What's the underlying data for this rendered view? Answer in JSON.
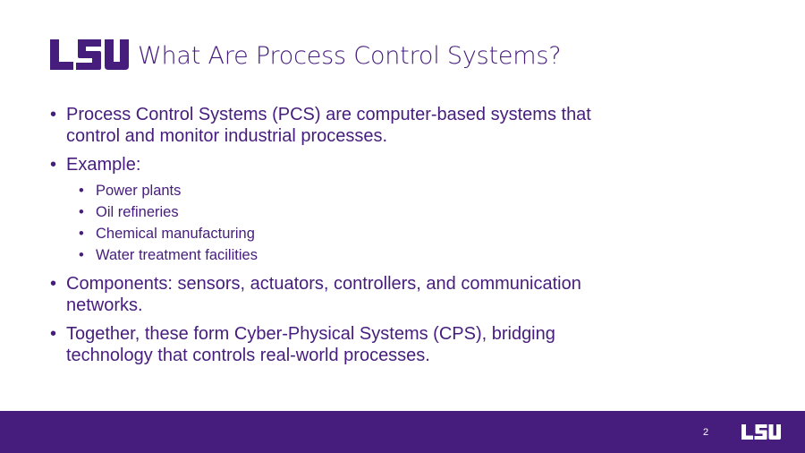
{
  "slide": {
    "title": "What Are Process Control Systems?",
    "logo_text": "LSU",
    "page_number": "2",
    "colors": {
      "purple": "#461D7C",
      "white": "#FFFFFF"
    }
  },
  "bullets": [
    {
      "text": "Process Control Systems (PCS) are computer-based systems that",
      "text2": "control and monitor industrial processes."
    },
    {
      "text": "Example:"
    },
    {
      "text": "Components: sensors, actuators, controllers, and communication",
      "text2": "networks."
    },
    {
      "text": "Together, these form Cyber-Physical Systems (CPS), bridging",
      "text2": "technology that controls real-world processes."
    }
  ],
  "examples": [
    "Power plants",
    "Oil refineries",
    "Chemical manufacturing",
    "Water treatment facilities"
  ]
}
